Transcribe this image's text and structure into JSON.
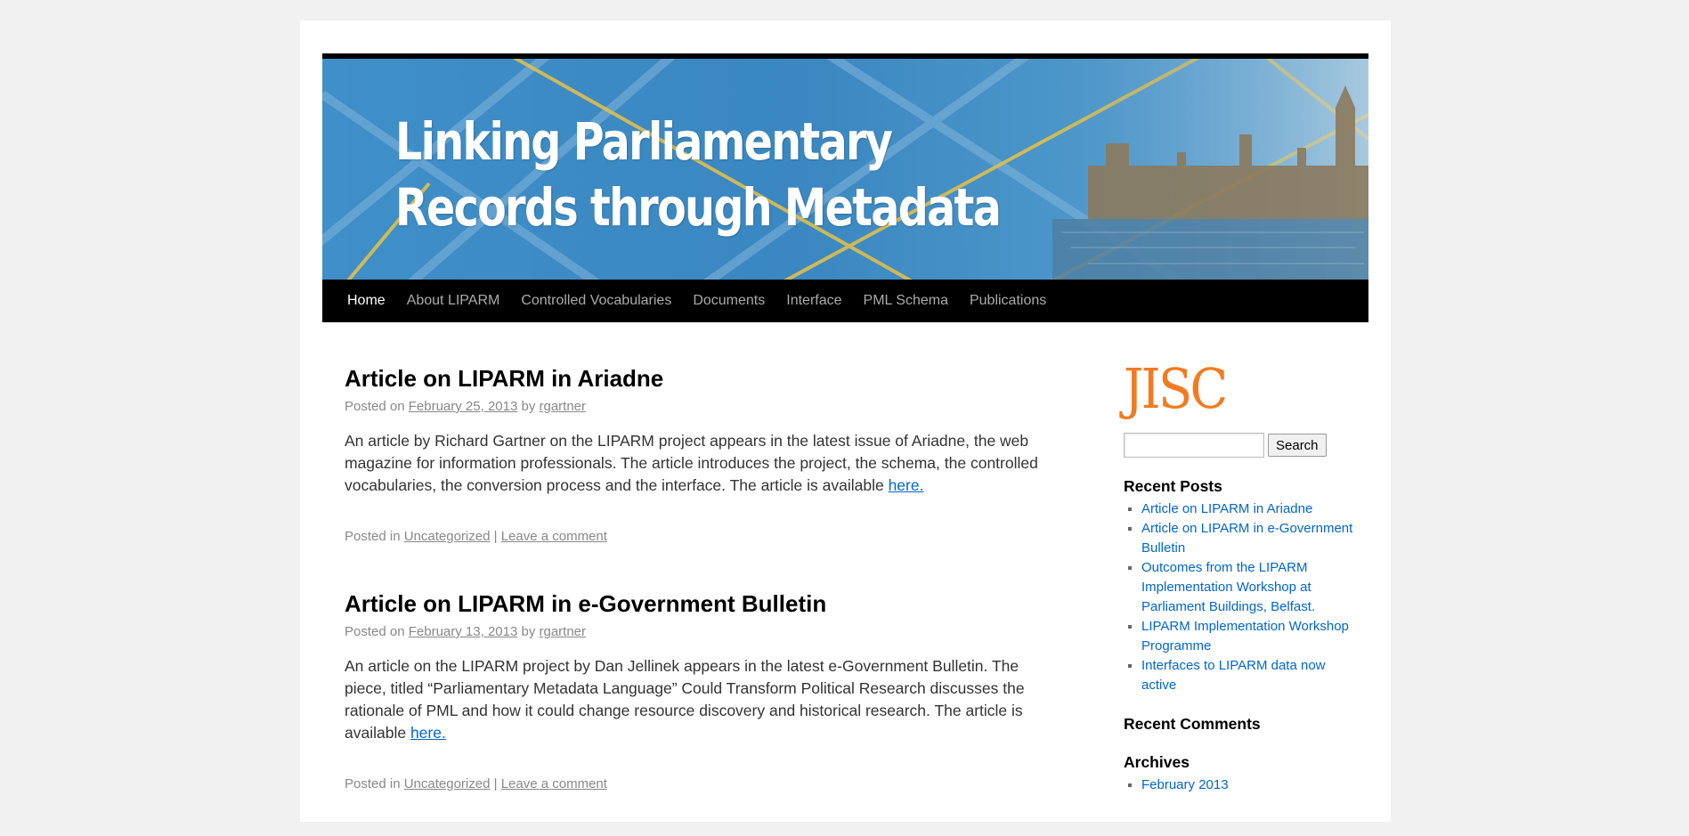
{
  "header": {
    "banner_line1": "Linking Parliamentary",
    "banner_line2": "Records through Metadata"
  },
  "nav": {
    "items": [
      {
        "label": "Home"
      },
      {
        "label": "About LIPARM"
      },
      {
        "label": "Controlled Vocabularies"
      },
      {
        "label": "Documents"
      },
      {
        "label": "Interface"
      },
      {
        "label": "PML Schema"
      },
      {
        "label": "Publications"
      }
    ]
  },
  "posts": [
    {
      "title": "Article on LIPARM in Ariadne",
      "posted_on": "Posted on",
      "date": "February 25, 2013",
      "by": "by",
      "author": "rgartner",
      "body": "An article by Richard Gartner on the LIPARM project appears in the latest issue of Ariadne, the web magazine for information professionals. The article introduces the project, the schema, the controlled vocabularies, the conversion process and the interface. The article is available ",
      "link": "here.",
      "posted_in": "Posted in",
      "category": "Uncategorized",
      "separator": "|",
      "comment_link": "Leave a comment"
    },
    {
      "title": "Article on LIPARM in e-Government Bulletin",
      "posted_on": "Posted on",
      "date": "February 13, 2013",
      "by": "by",
      "author": "rgartner",
      "body": "An article on the LIPARM project by Dan Jellinek appears in the latest e-Government Bulletin. The piece, titled “Parliamentary Metadata Language” Could Transform Political Research discusses the rationale of PML and how it could change resource discovery and historical research. The article is available ",
      "link": "here.",
      "posted_in": "Posted in",
      "category": "Uncategorized",
      "separator": "|",
      "comment_link": "Leave a comment"
    }
  ],
  "sidebar": {
    "logo_text": "JISC",
    "search": {
      "value": "",
      "button": "Search"
    },
    "recent_posts": {
      "title": "Recent Posts",
      "items": [
        "Article on LIPARM in Ariadne",
        "Article on LIPARM in e-Government Bulletin",
        "Outcomes from the LIPARM Implementation Workshop at Parliament Buildings, Belfast.",
        "LIPARM Implementation Workshop Programme",
        "Interfaces to LIPARM data now active"
      ]
    },
    "recent_comments": {
      "title": "Recent Comments"
    },
    "archives": {
      "title": "Archives",
      "items": [
        "February 2013"
      ]
    }
  },
  "colors": {
    "accent_link": "#0066cc",
    "jisc_orange": "#f37a20",
    "nav_bg": "#000000"
  }
}
